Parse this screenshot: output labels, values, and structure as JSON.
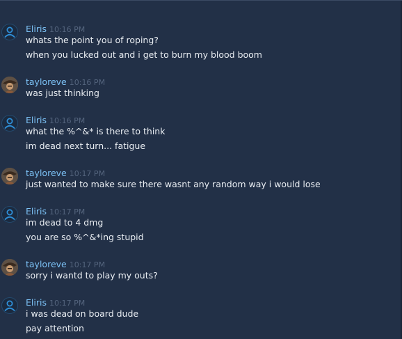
{
  "groups": [
    {
      "user": "Eliris",
      "time": "10:16 PM",
      "avatar": "default-user-icon",
      "messages": [
        "whats the point you of roping?",
        "when you lucked out and i get to burn my blood boom"
      ]
    },
    {
      "user": "tayloreve",
      "time": "10:16 PM",
      "avatar": "photo-avatar",
      "messages": [
        "was just thinking"
      ]
    },
    {
      "user": "Eliris",
      "time": "10:16 PM",
      "avatar": "default-user-icon",
      "messages": [
        "what the %^&* is there to think",
        "im dead next turn... fatigue"
      ]
    },
    {
      "user": "tayloreve",
      "time": "10:17 PM",
      "avatar": "photo-avatar",
      "messages": [
        "just wanted to make sure there wasnt any random way i would lose"
      ]
    },
    {
      "user": "Eliris",
      "time": "10:17 PM",
      "avatar": "default-user-icon",
      "messages": [
        "im dead to 4 dmg",
        "you are so %^&*ing stupid"
      ]
    },
    {
      "user": "tayloreve",
      "time": "10:17 PM",
      "avatar": "photo-avatar",
      "messages": [
        "sorry i wantd to play my outs?"
      ]
    },
    {
      "user": "Eliris",
      "time": "10:17 PM",
      "avatar": "default-user-icon",
      "messages": [
        "i was dead on board dude",
        "pay attention"
      ]
    }
  ],
  "colors": {
    "background": "#223047",
    "username": "#7cc1f5",
    "timestamp": "#55657e",
    "text": "#e9edf2"
  }
}
